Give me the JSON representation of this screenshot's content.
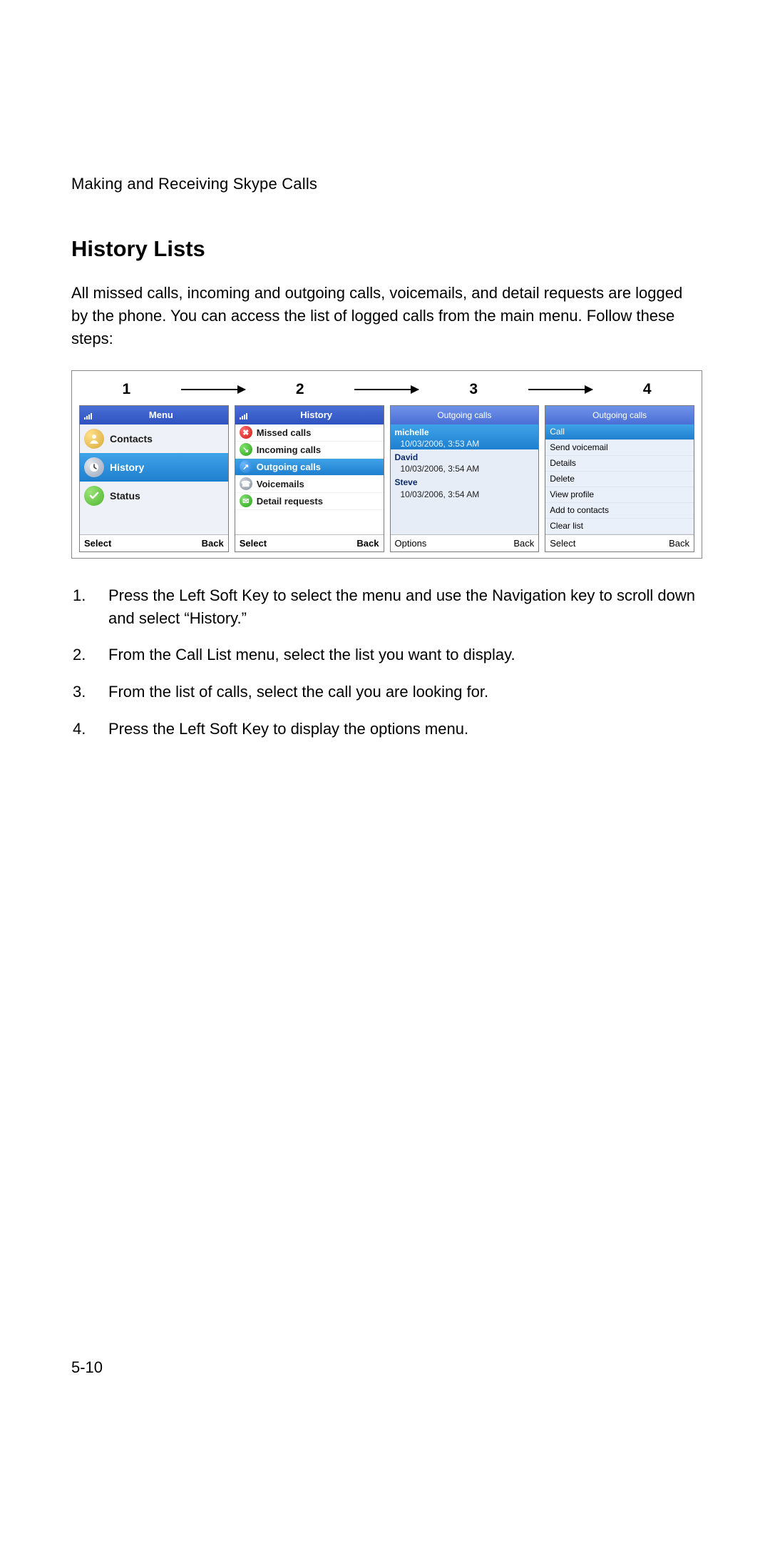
{
  "section_header": "Making and Receiving Skype Calls",
  "title": "History Lists",
  "intro": "All missed calls, incoming and outgoing calls, voicemails, and detail requests are logged by the phone. You can access the list of logged calls from the main menu. Follow these steps:",
  "figure": {
    "step_labels": [
      "1",
      "2",
      "3",
      "4"
    ],
    "screen1": {
      "title": "Menu",
      "items": [
        {
          "label": "Contacts",
          "selected": false,
          "icon": "contacts-icon"
        },
        {
          "label": "History",
          "selected": true,
          "icon": "clock-icon"
        },
        {
          "label": "Status",
          "selected": false,
          "icon": "check-icon"
        }
      ],
      "softkeys": {
        "left": "Select",
        "right": "Back"
      }
    },
    "screen2": {
      "title": "History",
      "items": [
        {
          "label": "Missed calls",
          "icon": "missed-icon",
          "selected": false
        },
        {
          "label": "Incoming calls",
          "icon": "incoming-icon",
          "selected": false
        },
        {
          "label": "Outgoing calls",
          "icon": "outgoing-icon",
          "selected": true
        },
        {
          "label": "Voicemails",
          "icon": "voicemail-icon",
          "selected": false
        },
        {
          "label": "Detail requests",
          "icon": "detail-icon",
          "selected": false
        }
      ],
      "softkeys": {
        "left": "Select",
        "right": "Back"
      }
    },
    "screen3": {
      "title": "Outgoing calls",
      "entries": [
        {
          "name": "michelle",
          "ts": "10/03/2006,  3:53 AM",
          "selected": true
        },
        {
          "name": "David",
          "ts": "10/03/2006,  3:54 AM",
          "selected": false
        },
        {
          "name": "Steve",
          "ts": "10/03/2006,  3:54 AM",
          "selected": false
        }
      ],
      "softkeys": {
        "left": "Options",
        "right": "Back"
      }
    },
    "screen4": {
      "title": "Outgoing calls",
      "options": [
        {
          "label": "Call",
          "selected": true
        },
        {
          "label": "Send voicemail",
          "selected": false
        },
        {
          "label": "Details",
          "selected": false
        },
        {
          "label": "Delete",
          "selected": false
        },
        {
          "label": "View profile",
          "selected": false
        },
        {
          "label": "Add to contacts",
          "selected": false
        },
        {
          "label": "Clear list",
          "selected": false
        }
      ],
      "softkeys": {
        "left": "Select",
        "right": "Back"
      }
    }
  },
  "steps": [
    {
      "num": "1.",
      "text": "Press the Left Soft Key to select the menu and use the Navigation key to scroll down and select “History.”"
    },
    {
      "num": "2.",
      "text": "From the Call List menu, select the list you want to display."
    },
    {
      "num": "3.",
      "text": "From the list of calls, select the call you are looking for."
    },
    {
      "num": "4.",
      "text": "Press the Left Soft Key to display the options menu."
    }
  ],
  "page_number": "5-10"
}
